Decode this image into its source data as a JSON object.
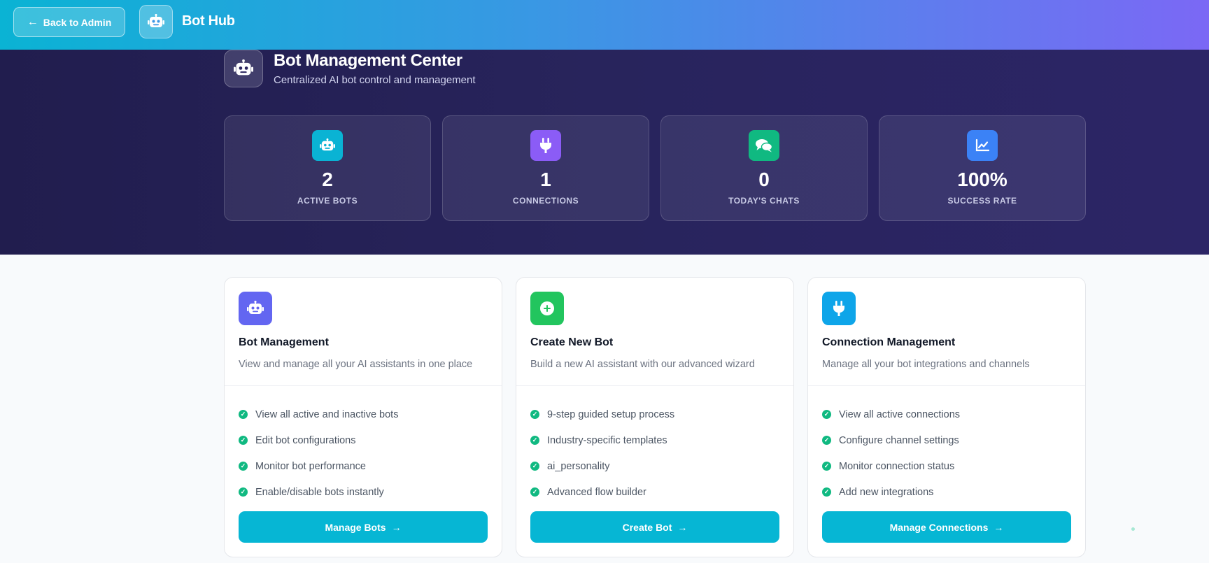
{
  "topbar": {
    "back_label": "Back to Admin",
    "brand_title": "Bot Hub"
  },
  "hero": {
    "title": "Bot Management Center",
    "subtitle": "Centralized AI bot control and management"
  },
  "stats": [
    {
      "value": "2",
      "label": "ACTIVE BOTS",
      "icon": "robot-icon",
      "color": "#0ab3d4"
    },
    {
      "value": "1",
      "label": "CONNECTIONS",
      "icon": "plug-icon",
      "color": "#8b5cf6"
    },
    {
      "value": "0",
      "label": "TODAY'S CHATS",
      "icon": "chat-icon",
      "color": "#10b981"
    },
    {
      "value": "100%",
      "label": "SUCCESS RATE",
      "icon": "chart-line-icon",
      "color": "#3b82f6"
    }
  ],
  "cards": [
    {
      "title": "Bot Management",
      "description": "View and manage all your AI assistants in one place",
      "icon": "robot-icon",
      "color": "#6366f1",
      "features": [
        "View all active and inactive bots",
        "Edit bot configurations",
        "Monitor bot performance",
        "Enable/disable bots instantly"
      ],
      "button": "Manage Bots"
    },
    {
      "title": "Create New Bot",
      "description": "Build a new AI assistant with our advanced wizard",
      "icon": "plus-circle-icon",
      "color": "#22c55e",
      "features": [
        "9-step guided setup process",
        "Industry-specific templates",
        "ai_personality",
        "Advanced flow builder"
      ],
      "button": "Create Bot"
    },
    {
      "title": "Connection Management",
      "description": "Manage all your bot integrations and channels",
      "icon": "plug-icon",
      "color": "#0ea5e9",
      "features": [
        "View all active connections",
        "Configure channel settings",
        "Monitor connection status",
        "Add new integrations"
      ],
      "button": "Manage Connections"
    }
  ]
}
